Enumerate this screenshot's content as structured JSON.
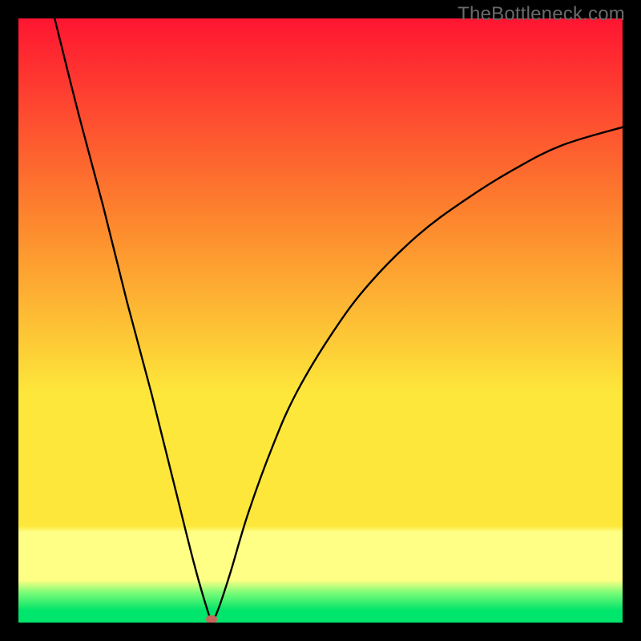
{
  "watermark": "TheBottleneck.com",
  "colors": {
    "top": "#fe1531",
    "mid_upper": "#fd8c2e",
    "mid": "#fde73a",
    "yellow_band": "#feff84",
    "green_top": "#7dfc77",
    "green": "#00e56b",
    "curve": "#000000",
    "marker": "#c6665c",
    "frame": "#000000"
  },
  "chart_data": {
    "type": "line",
    "title": "",
    "xlabel": "",
    "ylabel": "",
    "xlim": [
      0,
      100
    ],
    "ylim": [
      0,
      100
    ],
    "notes": "Bottleneck-style curve: minimum (optimal balance) near x≈32 at y≈0. Left branch rises steeply beyond top edge by x≈6. Right branch rises with diminishing slope, reaching right edge (x=100) at y≈82.",
    "series": [
      {
        "name": "bottleneck-curve",
        "x": [
          6,
          10,
          14,
          18,
          22,
          26,
          29,
          31,
          32,
          33,
          35,
          38,
          42,
          46,
          52,
          58,
          66,
          74,
          82,
          90,
          100
        ],
        "y": [
          100,
          84,
          69,
          53,
          38,
          22,
          10,
          3,
          0.5,
          2,
          8,
          18,
          29,
          38,
          48,
          56,
          64,
          70,
          75,
          79,
          82
        ]
      }
    ],
    "marker": {
      "x": 32,
      "y": 0.5
    }
  },
  "layout": {
    "plot_left": 23,
    "plot_top": 23,
    "plot_size": 754
  }
}
